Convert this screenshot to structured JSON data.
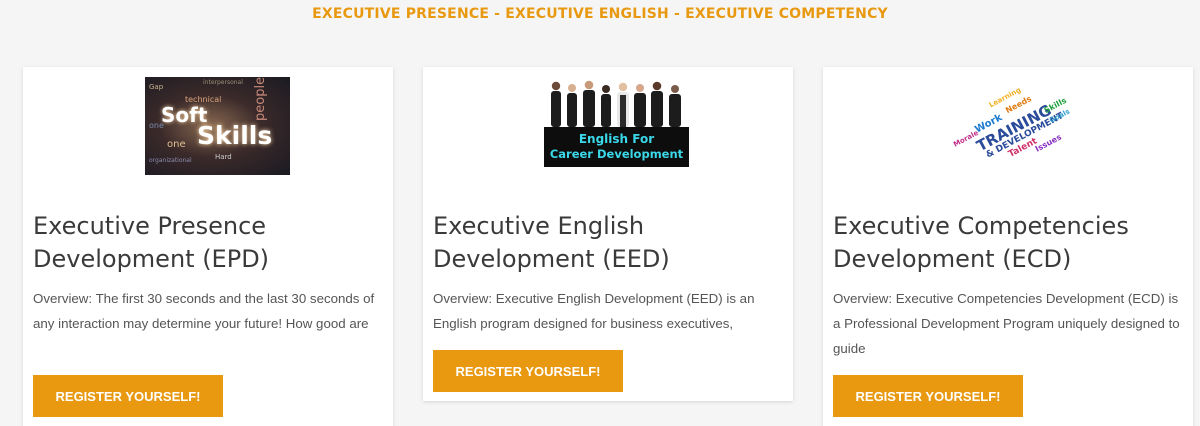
{
  "header": {
    "headline": "EXECUTIVE PRESENCE - EXECUTIVE ENGLISH - EXECUTIVE COMPETENCY"
  },
  "cards": [
    {
      "title": "Executive Presence Development (EPD)",
      "overview": "Overview: The first 30 seconds and the last 30 seconds of any interaction may determine your future! How good are",
      "button": "REGISTER YOURSELF!",
      "image_words": [
        "Soft",
        "Skills",
        "people",
        "technical",
        "Hard",
        "one",
        "Gap",
        "interpersonal",
        "organizational"
      ]
    },
    {
      "title": "Executive English Development (EED)",
      "overview": "Overview: Executive English Development (EED) is an English program designed for business executives,",
      "button": "REGISTER YOURSELF!",
      "image_words": [
        "English For",
        "Career Development"
      ]
    },
    {
      "title": "Executive Competencies Development (ECD)",
      "overview": "Overview: Executive Competencies Development (ECD) is a Professional Development Program uniquely designed to guide",
      "button": "REGISTER YOURSELF!",
      "image_words": [
        "TRAINING",
        "& DEVELOPMENT",
        "Talent",
        "Work",
        "Needs",
        "Morale",
        "Learning",
        "Issues",
        "Skills",
        "Goals"
      ]
    }
  ],
  "colors": {
    "accent": "#e8990f",
    "title_text": "#3a3a3a",
    "body_text": "#555555",
    "page_bg": "#f5f5f5",
    "card_bg": "#ffffff"
  }
}
